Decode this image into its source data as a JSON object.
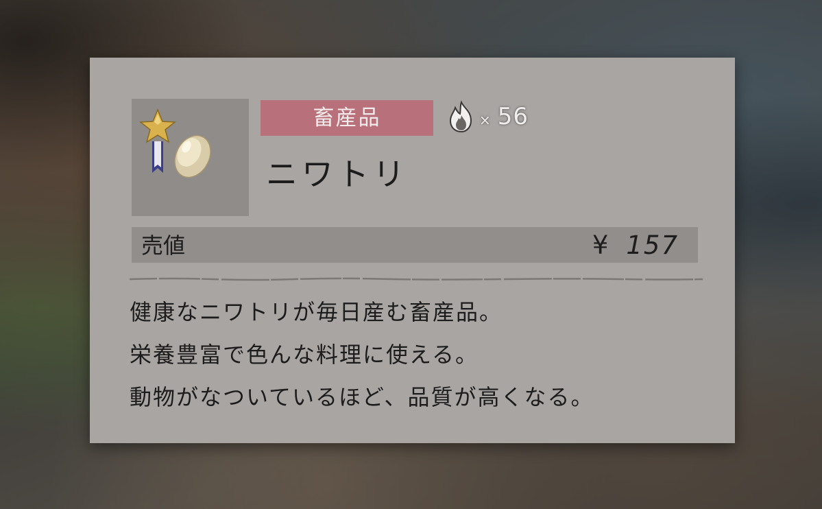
{
  "item": {
    "category": "畜産品",
    "heat_multiplier": "×",
    "heat_count": "56",
    "name": "ニワトリ",
    "icon": "egg-with-star-ribbon-icon"
  },
  "price": {
    "label": "売値",
    "currency": "¥",
    "value": "157"
  },
  "description": [
    "健康なニワトリが毎日産む畜産品。",
    "栄養豊富で色んな料理に使える。",
    "動物がなついているほど、品質が高くなる。"
  ],
  "colors": {
    "panel": "#a9a5a3",
    "category_badge": "#b8707a",
    "price_bar": "#918e8c",
    "thumbnail": "#8f8c8a"
  }
}
